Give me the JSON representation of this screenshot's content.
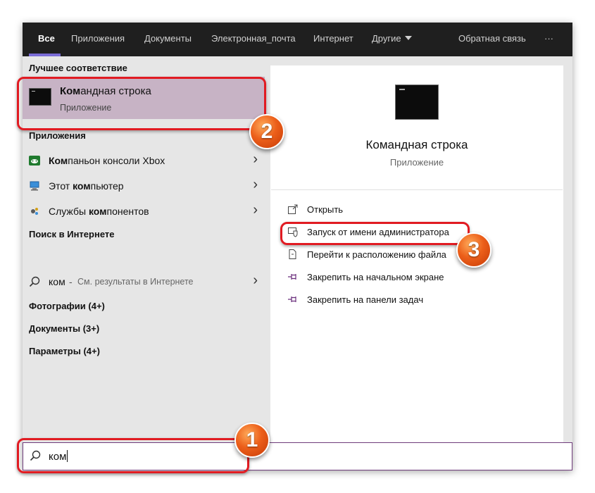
{
  "tabs": [
    "Все",
    "Приложения",
    "Документы",
    "Электронная_почта",
    "Интернет",
    "Другие",
    "Обратная связь",
    "···"
  ],
  "left": {
    "best_match_heading": "Лучшее соответствие",
    "best_match": {
      "title_bold": "Ком",
      "title_rest": "андная строка",
      "subtitle": "Приложение",
      "icon": "command-prompt-icon"
    },
    "apps_heading": "Приложения",
    "apps": [
      {
        "bold": "Ком",
        "rest": "паньон консоли Xbox",
        "icon": "xbox-icon"
      },
      {
        "pre": "Этот ",
        "bold": "ком",
        "rest": "пьютер",
        "icon": "computer-icon"
      },
      {
        "pre": "Службы ",
        "bold": "ком",
        "rest": "понентов",
        "icon": "component-services-icon"
      }
    ],
    "web_heading": "Поиск в Интернете",
    "web": {
      "query": "ком",
      "sep": "-",
      "desc": "См. результаты в Интернете",
      "icon": "search-icon"
    },
    "photos": "Фотографии (4+)",
    "documents": "Документы (3+)",
    "settings": "Параметры (4+)"
  },
  "detail": {
    "title": "Командная строка",
    "subtitle": "Приложение",
    "actions": [
      {
        "label": "Открыть",
        "icon": "open-icon"
      },
      {
        "label": "Запуск от имени администратора",
        "icon": "run-as-admin-icon"
      },
      {
        "label": "Перейти к расположению файла",
        "icon": "file-location-icon"
      },
      {
        "label": "Закрепить на начальном экране",
        "icon": "pin-start-icon"
      },
      {
        "label": "Закрепить на панели задач",
        "icon": "pin-taskbar-icon"
      }
    ]
  },
  "search": {
    "value": "ком"
  },
  "badges": [
    "1",
    "2",
    "3"
  ],
  "colors": {
    "accent": "#7a6cd6",
    "highlight": "#e11b22",
    "best_match_bg": "#c7b3c5",
    "topbar_bg": "#1f1f1f",
    "badge": "#ec5f1a"
  }
}
